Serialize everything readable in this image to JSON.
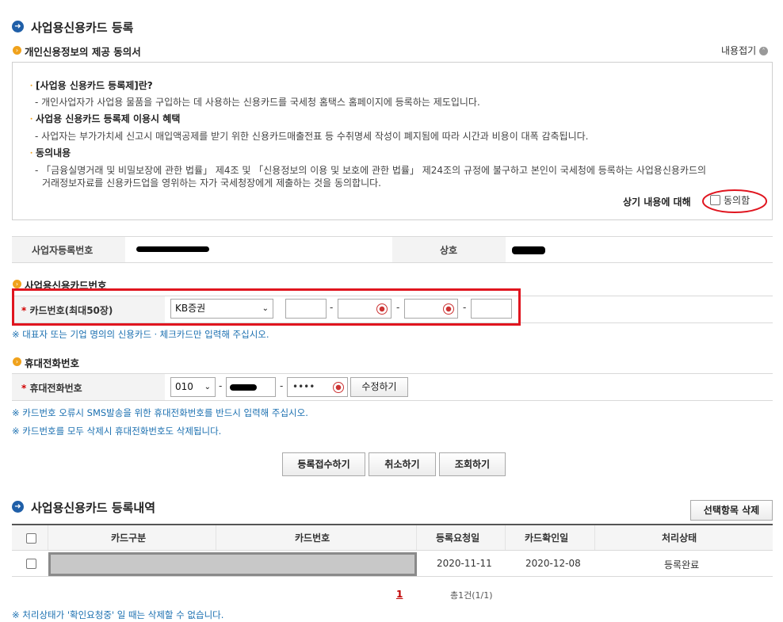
{
  "title": "사업용신용카드 등록",
  "consent": {
    "heading": "개인신용정보의 제공 동의서",
    "collapse_label": "내용접기",
    "item1_title": "[사업용 신용카드 등록제]란?",
    "item1_desc": "- 개인사업자가 사업용 물품을 구입하는 데 사용하는 신용카드를 국세청 홈택스 홈페이지에 등록하는 제도입니다.",
    "item2_title": "사업용 신용카드 등록제 이용시 혜택",
    "item2_desc": "- 사업자는 부가가치세 신고시 매입액공제를 받기 위한 신용카드매출전표 등 수취명세 작성이 폐지됨에 따라 시간과 비용이 대폭 감축됩니다.",
    "item3_title": "동의내용",
    "item3_desc_line1": "- 「금융실명거래 및 비밀보장에 관한 법률」 제4조 및 「신용정보의 이용 및 보호에 관한 법률」 제24조의 규정에 불구하고 본인이 국세청에 등록하는 사업용신용카드의",
    "item3_desc_line2": "거래정보자료를 신용카드업을 영위하는 자가 국세청장에게 제출하는 것을 동의합니다.",
    "agree_prompt": "상기 내용에 대해",
    "agree_label": "동의함"
  },
  "business": {
    "reg_label": "사업자등록번호",
    "name_label": "상호"
  },
  "card_section": {
    "heading": "사업용신용카드번호",
    "field_label": "카드번호(최대50장)",
    "card_company": "KB증권",
    "note": "※ 대표자 또는 기업 명의의 신용카드ㆍ체크카드만 입력해 주십시오."
  },
  "phone_section": {
    "heading": "휴대전화번호",
    "field_label": "휴대전화번호",
    "prefix": "010",
    "last_masked": "••••",
    "edit_button": "수정하기",
    "note1": "※ 카드번호 오류시 SMS발송을 위한 휴대전화번호를 반드시 입력해 주십시오.",
    "note2": "※ 카드번호를 모두 삭제시 휴대전화번호도 삭제됩니다."
  },
  "actions": {
    "register": "등록접수하기",
    "cancel": "취소하기",
    "inquiry": "조회하기"
  },
  "history": {
    "title": "사업용신용카드 등록내역",
    "delete_selected": "선택항목 삭제",
    "columns": [
      "카드구분",
      "카드번호",
      "등록요청일",
      "카드확인일",
      "처리상태"
    ],
    "rows": [
      {
        "request_date": "2020-11-11",
        "confirm_date": "2020-12-08",
        "status": "등록완료"
      }
    ],
    "page_current": "1",
    "total": "총1건(1/1)",
    "footnote": "※ 처리상태가 '확인요청중' 일 때는 삭제할 수 없습니다."
  },
  "colors": {
    "accent_blue": "#1f5fa8",
    "accent_orange": "#f0a21c",
    "annotation_red": "#e0151f",
    "note_blue": "#1a6fb0"
  }
}
